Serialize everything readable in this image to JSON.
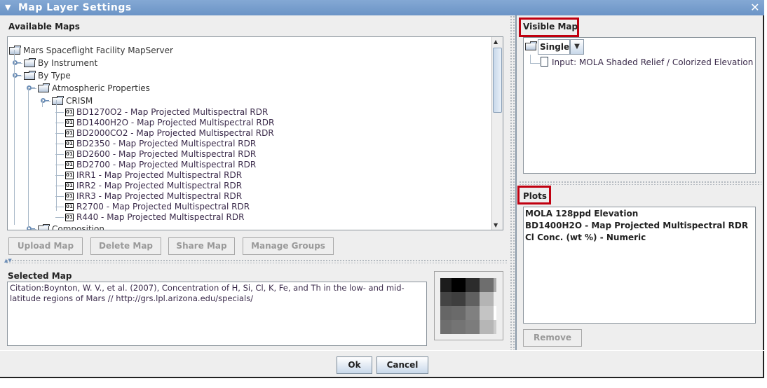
{
  "window": {
    "title": "Map Layer Settings",
    "close_icon": "close-icon"
  },
  "available": {
    "label": "Available Maps",
    "tree": [
      {
        "label": "Mars Spaceflight Facility MapServer",
        "type": "folder",
        "level": 0
      },
      {
        "label": "By Instrument",
        "type": "folder",
        "level": 1
      },
      {
        "label": "By Type",
        "type": "folder",
        "level": 1
      },
      {
        "label": "Atmospheric Properties",
        "type": "folder",
        "level": 2
      },
      {
        "label": "CRISM",
        "type": "folder",
        "level": 3
      },
      {
        "label": "BD1270O2 - Map Projected Multispectral RDR",
        "type": "map",
        "level": 4
      },
      {
        "label": "BD1400H2O - Map Projected Multispectral RDR",
        "type": "map",
        "level": 4
      },
      {
        "label": "BD2000CO2 - Map Projected Multispectral RDR",
        "type": "map",
        "level": 4
      },
      {
        "label": "BD2350 - Map Projected Multispectral RDR",
        "type": "map",
        "level": 4
      },
      {
        "label": "BD2600 - Map Projected Multispectral RDR",
        "type": "map",
        "level": 4
      },
      {
        "label": "BD2700 - Map Projected Multispectral RDR",
        "type": "map",
        "level": 4
      },
      {
        "label": "IRR1 - Map Projected Multispectral RDR",
        "type": "map",
        "level": 4
      },
      {
        "label": "IRR2 - Map Projected Multispectral RDR",
        "type": "map",
        "level": 4
      },
      {
        "label": "IRR3 - Map Projected Multispectral RDR",
        "type": "map",
        "level": 4
      },
      {
        "label": "R2700 - Map Projected Multispectral RDR",
        "type": "map",
        "level": 4
      },
      {
        "label": "R440 - Map Projected Multispectral RDR",
        "type": "map",
        "level": 4
      },
      {
        "label": "Composition",
        "type": "folder",
        "level": 2
      }
    ],
    "map_icon_text": "01",
    "buttons": [
      "Upload Map",
      "Delete Map",
      "Share Map",
      "Manage Groups"
    ]
  },
  "selected": {
    "label": "Selected Map",
    "text": "Citation:Boynton, W. V., et al. (2007), Concentration of H, Si, Cl, K, Fe, and Th in the low- and mid-latitude regions of Mars // http://grs.lpl.arizona.edu/specials/",
    "thumbnail": [
      [
        "#1c1c1c",
        "#000000",
        "#2c2c2c",
        "#6e6e6e",
        "#aaaaaa"
      ],
      [
        "#444444",
        "#3e3e3e",
        "#606060",
        "#b4b4b4",
        "#eeeeee"
      ],
      [
        "#666666",
        "#6a6a6a",
        "#808080",
        "#c4c4c4",
        "#ffffff"
      ],
      [
        "#6e6e6e",
        "#747474",
        "#7c7c7c",
        "#b6b6b6",
        "#cccccc"
      ]
    ]
  },
  "visible": {
    "label": "Visible Map",
    "combo": "Single",
    "input": "Input: MOLA Shaded Relief / Colorized Elevation"
  },
  "plots": {
    "label": "Plots",
    "items": [
      "MOLA 128ppd Elevation",
      "BD1400H2O - Map Projected Multispectral RDR",
      "Cl Conc. (wt %) - Numeric"
    ],
    "remove": "Remove"
  },
  "footer": {
    "ok": "Ok",
    "cancel": "Cancel"
  },
  "colors": {
    "title_bar": "#7aa0cf",
    "highlight": "#cc0010"
  }
}
